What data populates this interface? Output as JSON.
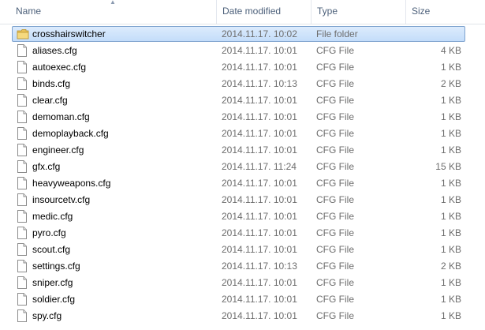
{
  "columns": {
    "name": "Name",
    "date_modified": "Date modified",
    "type": "Type",
    "size": "Size"
  },
  "files": [
    {
      "name": "crosshairswitcher",
      "date": "2014.11.17. 10:02",
      "type": "File folder",
      "size": "",
      "icon": "folder-icon",
      "selected": true
    },
    {
      "name": "aliases.cfg",
      "date": "2014.11.17. 10:01",
      "type": "CFG File",
      "size": "4 KB",
      "icon": "file-icon"
    },
    {
      "name": "autoexec.cfg",
      "date": "2014.11.17. 10:01",
      "type": "CFG File",
      "size": "1 KB",
      "icon": "file-icon"
    },
    {
      "name": "binds.cfg",
      "date": "2014.11.17. 10:13",
      "type": "CFG File",
      "size": "2 KB",
      "icon": "file-icon"
    },
    {
      "name": "clear.cfg",
      "date": "2014.11.17. 10:01",
      "type": "CFG File",
      "size": "1 KB",
      "icon": "file-icon"
    },
    {
      "name": "demoman.cfg",
      "date": "2014.11.17. 10:01",
      "type": "CFG File",
      "size": "1 KB",
      "icon": "file-icon"
    },
    {
      "name": "demoplayback.cfg",
      "date": "2014.11.17. 10:01",
      "type": "CFG File",
      "size": "1 KB",
      "icon": "file-icon"
    },
    {
      "name": "engineer.cfg",
      "date": "2014.11.17. 10:01",
      "type": "CFG File",
      "size": "1 KB",
      "icon": "file-icon"
    },
    {
      "name": "gfx.cfg",
      "date": "2014.11.17. 11:24",
      "type": "CFG File",
      "size": "15 KB",
      "icon": "file-icon"
    },
    {
      "name": "heavyweapons.cfg",
      "date": "2014.11.17. 10:01",
      "type": "CFG File",
      "size": "1 KB",
      "icon": "file-icon"
    },
    {
      "name": "insourcetv.cfg",
      "date": "2014.11.17. 10:01",
      "type": "CFG File",
      "size": "1 KB",
      "icon": "file-icon"
    },
    {
      "name": "medic.cfg",
      "date": "2014.11.17. 10:01",
      "type": "CFG File",
      "size": "1 KB",
      "icon": "file-icon"
    },
    {
      "name": "pyro.cfg",
      "date": "2014.11.17. 10:01",
      "type": "CFG File",
      "size": "1 KB",
      "icon": "file-icon"
    },
    {
      "name": "scout.cfg",
      "date": "2014.11.17. 10:01",
      "type": "CFG File",
      "size": "1 KB",
      "icon": "file-icon"
    },
    {
      "name": "settings.cfg",
      "date": "2014.11.17. 10:13",
      "type": "CFG File",
      "size": "2 KB",
      "icon": "file-icon"
    },
    {
      "name": "sniper.cfg",
      "date": "2014.11.17. 10:01",
      "type": "CFG File",
      "size": "1 KB",
      "icon": "file-icon"
    },
    {
      "name": "soldier.cfg",
      "date": "2014.11.17. 10:01",
      "type": "CFG File",
      "size": "1 KB",
      "icon": "file-icon"
    },
    {
      "name": "spy.cfg",
      "date": "2014.11.17. 10:01",
      "type": "CFG File",
      "size": "1 KB",
      "icon": "file-icon"
    }
  ]
}
